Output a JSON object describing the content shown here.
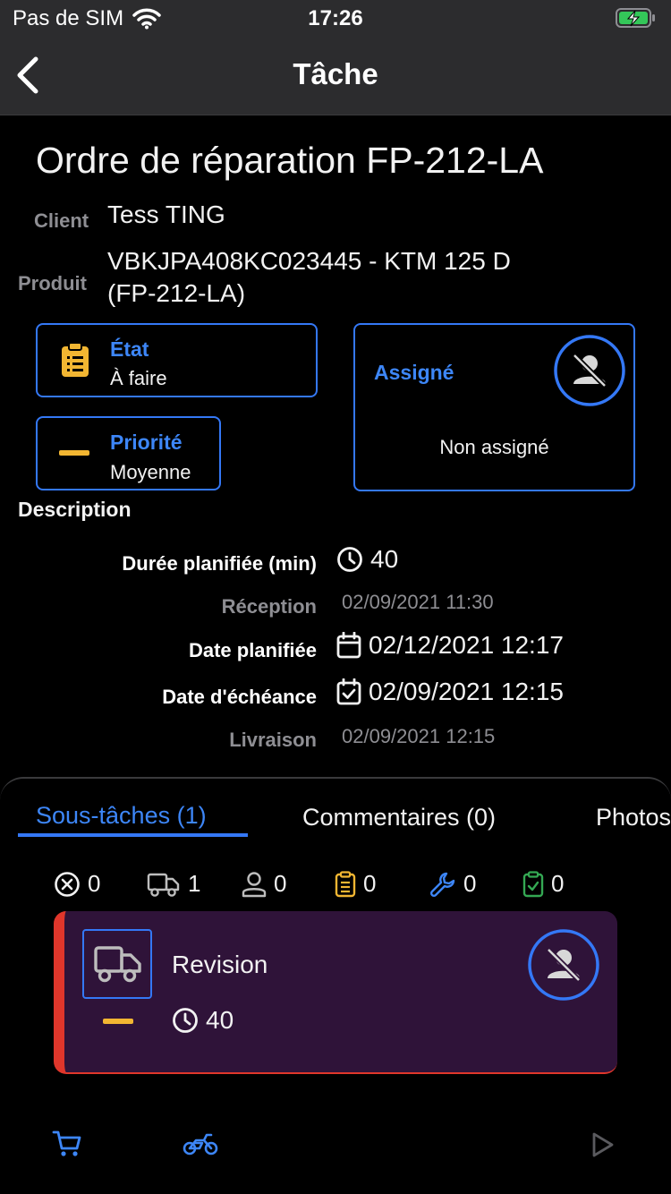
{
  "status_bar": {
    "carrier": "Pas de SIM",
    "time": "17:26"
  },
  "nav": {
    "title": "Tâche"
  },
  "order": {
    "title": "Ordre de réparation FP-212-LA",
    "client_label": "Client",
    "client_value": "Tess TING",
    "product_label": "Produit",
    "product_line1": "VBKJPA408KC023445 - KTM 125 D",
    "product_line2": "(FP-212-LA)"
  },
  "cards": {
    "state_title": "État",
    "state_value": "À faire",
    "priority_title": "Priorité",
    "priority_value": "Moyenne",
    "assigned_title": "Assigné",
    "assigned_value": "Non assigné"
  },
  "details": {
    "section_title": "Description",
    "planned_duration_label": "Durée planifiée (min)",
    "planned_duration_value": "40",
    "reception_label": "Réception",
    "reception_value": "02/09/2021 11:30",
    "planned_date_label": "Date planifiée",
    "planned_date_value": "02/12/2021 12:17",
    "due_date_label": "Date d'échéance",
    "due_date_value": "02/09/2021 12:15",
    "delivery_label": "Livraison",
    "delivery_value": "02/09/2021 12:15"
  },
  "tabs": [
    {
      "label": "Sous-tâches (1)",
      "active": true
    },
    {
      "label": "Commentaires (0)",
      "active": false
    },
    {
      "label": "Photos",
      "active": false
    }
  ],
  "counters": [
    {
      "icon": "cancel-circle-icon",
      "value": "0"
    },
    {
      "icon": "truck-icon",
      "value": "1"
    },
    {
      "icon": "user-icon",
      "value": "0"
    },
    {
      "icon": "clipboard-icon",
      "value": "0"
    },
    {
      "icon": "wrench-icon",
      "value": "0"
    },
    {
      "icon": "clipboard-check-icon",
      "value": "0"
    }
  ],
  "subtask": {
    "name": "Revision",
    "duration": "40"
  },
  "colors": {
    "accent": "#3478f6",
    "warning": "#f2b632",
    "danger": "#e0362b",
    "success": "#34a853",
    "card_bg": "#2f1339"
  }
}
